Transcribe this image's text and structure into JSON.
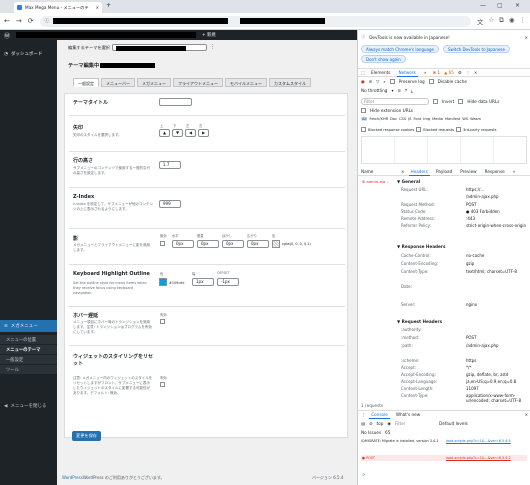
{
  "browser": {
    "tab_title": "Max Mega Menu - メニューのテ",
    "close": "×",
    "new_tab": "+",
    "win_controls": [
      "—",
      "▢",
      "×"
    ],
    "nav": [
      "←",
      "→",
      "⟳"
    ],
    "url_icon": "ⓘ"
  },
  "adminbar": {
    "new_label": "+ 新規"
  },
  "sidebar": {
    "dashboard": "ダッシュボード",
    "mega_menu": "メガメニュー",
    "subitems": [
      "メニューの位置",
      "メニューのテーマ",
      "一般設定",
      "ツール"
    ],
    "collapse": "メニューを閉じる"
  },
  "main": {
    "theme_select_label": "編集するテーマを選択",
    "theme_editor_title": "テーマ編集中",
    "tabs": [
      "一般設定",
      "メニューバー",
      "メガメニュー",
      "フライアウトメニュー",
      "モバイルメニュー",
      "カスタムスタイル"
    ],
    "rows": {
      "theme_title": {
        "label": "テーマタイトル"
      },
      "arrow": {
        "label": "矢印",
        "desc": "矢印のスタイルを選択します。",
        "dirs": [
          "上",
          "下",
          "左",
          "右"
        ],
        "values": [
          "▲",
          "▼",
          "◀",
          "▶"
        ]
      },
      "line_height": {
        "label": "行の高さ",
        "desc": "サブメニューのコンテンツで使用する一般的な行の高さを設定します。",
        "value": "1.7"
      },
      "zindex": {
        "label": "Z-Index",
        "desc": "z-index を設定して、サブメニューが他のコンテンツの上に表示されるようにします。",
        "value": "999"
      },
      "shadow": {
        "label": "影",
        "desc": "メガメニューとフライアウトメニューに影を適用します。",
        "cols": [
          "無効",
          "水平",
          "垂直",
          "ぼかし",
          "広がり",
          "色"
        ],
        "values": [
          "0px",
          "0px",
          "0px",
          "0px",
          "0px"
        ],
        "color": "rgba(0, 0, 0, 0.1)"
      },
      "keyboard": {
        "label": "Keyboard Highlight Outline",
        "desc": "Set the outline style for menu items when they receive focus using keyboard navigation.",
        "cols": [
          "色",
          "幅",
          "OFFSET"
        ],
        "color_value": "#109cde",
        "width_value": "1px",
        "offset_value": "-1px"
      },
      "hover": {
        "label": "ホバー遅延",
        "desc": "メニュー項目にホバー時のトランジションを適用します。注意: トランジションはプログラムを有効にしています。",
        "col": "有効"
      },
      "widget": {
        "label": "ウィジェットのスタイリングをリセット",
        "desc": "注意: メガメニュー内のウィジェットのスタイルをリセットしますがフロント、サブメニューに表示したウィジェットのスタイルに影響する可能性があります。デフォルト: 無効。",
        "col": "有効"
      }
    },
    "save_button": "変更を保存",
    "footer_left": "WordPress のご利用ありがとうございます。",
    "footer_right": "バージョン 6.5.4"
  },
  "devtools": {
    "banner_text": "DevTools is now available in Japanese!",
    "banner_btn1": "Always match Chrome's language",
    "banner_btn2": "Switch DevTools to Japanese",
    "banner_btn3": "Don't show again",
    "tabs": [
      "Elements",
      "Network",
      "»"
    ],
    "badges": {
      "errors": "1",
      "warnings": "65"
    },
    "toolbar": [
      "Preserve log",
      "Disable cache"
    ],
    "throttle": "No throttling",
    "filter_placeholder": "Filter",
    "filter_opts": [
      "Invert",
      "Hide data URLs"
    ],
    "hide_ext": "Hide extension URLs",
    "types": [
      "All",
      "Fetch/XHR",
      "Doc",
      "CSS",
      "JS",
      "Font",
      "Img",
      "Media",
      "Manifest",
      "WS",
      "Wasm"
    ],
    "blocked": [
      "Blocked response cookies",
      "Blocked requests",
      "3rd-party requests"
    ],
    "list_header": "Name",
    "detail_tabs": [
      "×",
      "Headers",
      "Payload",
      "Preview",
      "Response",
      "»"
    ],
    "req_name": "admin-aja...",
    "general_title": "▼ General",
    "general": [
      [
        "Request URL:",
        "https://..."
      ],
      [
        "",
        "/admin-ajax.php"
      ],
      [
        "Request Method:",
        "POST"
      ],
      [
        "Status Code:",
        "● 403 Forbidden"
      ],
      [
        "Remote Address:",
        ":443"
      ],
      [
        "Referrer Policy:",
        "strict-origin-when-cross-origin"
      ]
    ],
    "response_title": "▼ Response Headers",
    "response": [
      [
        "Cache-Control:",
        "no-cache"
      ],
      [
        "Content-Encoding:",
        "gzip"
      ],
      [
        "Content-Type:",
        "text/html; charset=UTF-8"
      ],
      [
        "Date:",
        ""
      ],
      [
        "Server:",
        "nginx"
      ]
    ],
    "request_title": "▼ Request Headers",
    "request": [
      [
        ":authority:",
        ""
      ],
      [
        ":method:",
        "POST"
      ],
      [
        ":path:",
        "/admin-ajax.php"
      ],
      [
        ":scheme:",
        "https"
      ],
      [
        "Accept:",
        "*/*"
      ],
      [
        "Accept-Encoding:",
        "gzip, deflate, br, zstd"
      ],
      [
        "Accept-Language:",
        "ja,en-US;q=0.9,en;q=0.8"
      ],
      [
        "Content-Length:",
        "11097"
      ],
      [
        "Content-Type:",
        "application/x-www-form-urlencoded; charset=UTF-8"
      ]
    ],
    "status_bar": "1 requests",
    "console_tabs": [
      "Console",
      "What's new"
    ],
    "console_top": "top",
    "console_filter": "Filter",
    "console_levels": "Default levels",
    "no_issues": "No Issues",
    "no_issues_count": "65",
    "console_lines": [
      [
        "JQMIGRATE: Migrate is installed, version 3.4.1",
        "load-scripts.php?c=1&...&ver=6.5.4:5"
      ],
      [
        "● POST",
        "load-scripts.php?c=1&...&ver=6.5.4:2"
      ]
    ],
    "console_prompt": ">"
  }
}
